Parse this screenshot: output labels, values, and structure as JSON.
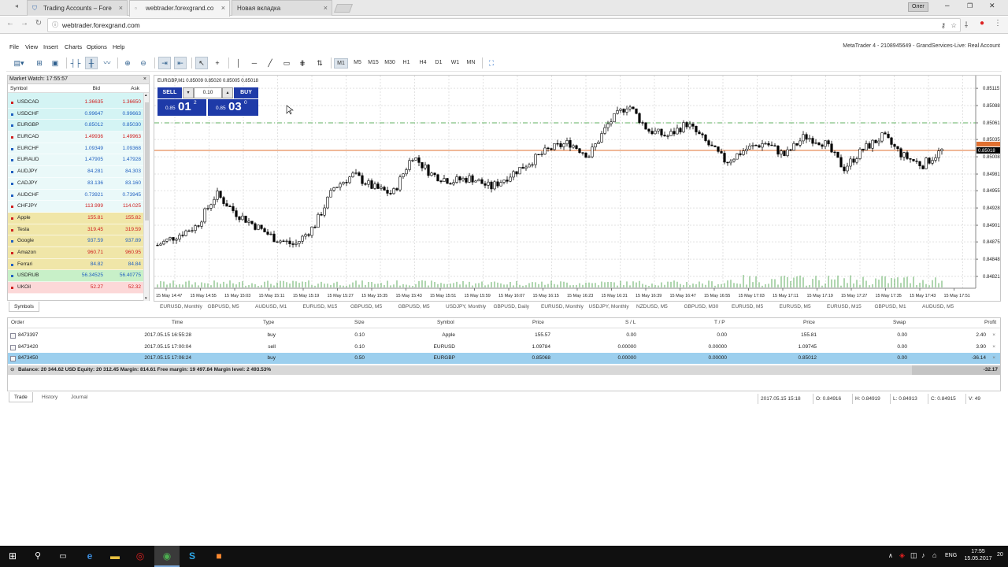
{
  "browser": {
    "user": "Олег",
    "tabs": [
      {
        "title": "Trading Accounts – Fore"
      },
      {
        "title": "webtrader.forexgrand.co"
      },
      {
        "title": "Новая вкладка"
      }
    ],
    "url": "webtrader.forexgrand.com"
  },
  "menu": {
    "items": [
      "File",
      "View",
      "Insert",
      "Charts",
      "Options",
      "Help"
    ],
    "account": "MetaTrader 4 - 2108945649 - GrandServices-Live: Real Account"
  },
  "toolbar": {
    "timeframes": [
      "M1",
      "M5",
      "M15",
      "M30",
      "H1",
      "H4",
      "D1",
      "W1",
      "MN"
    ],
    "active_timeframe": "M1"
  },
  "market_watch": {
    "title": "Market Watch: 17:55:57",
    "cols": {
      "symbol": "Symbol",
      "bid": "Bid",
      "ask": "Ask"
    },
    "rows": [
      {
        "symbol": "USDCAD",
        "bid": "1.36635",
        "ask": "1.36650",
        "dir": "down",
        "group": "fx"
      },
      {
        "symbol": "USDCHF",
        "bid": "0.99647",
        "ask": "0.99663",
        "dir": "up",
        "group": "fx"
      },
      {
        "symbol": "EURGBP",
        "bid": "0.85012",
        "ask": "0.85030",
        "dir": "up",
        "group": "fx"
      },
      {
        "symbol": "EURCAD",
        "bid": "1.49936",
        "ask": "1.49963",
        "dir": "down",
        "group": "fx2"
      },
      {
        "symbol": "EURCHF",
        "bid": "1.09349",
        "ask": "1.09368",
        "dir": "up",
        "group": "fx2"
      },
      {
        "symbol": "EURAUD",
        "bid": "1.47905",
        "ask": "1.47928",
        "dir": "up",
        "group": "fx2"
      },
      {
        "symbol": "AUDJPY",
        "bid": "84.281",
        "ask": "84.303",
        "dir": "up",
        "group": "fx2"
      },
      {
        "symbol": "CADJPY",
        "bid": "83.136",
        "ask": "83.160",
        "dir": "up",
        "group": "fx2"
      },
      {
        "symbol": "AUDCHF",
        "bid": "0.73921",
        "ask": "0.73945",
        "dir": "up",
        "group": "fx2"
      },
      {
        "symbol": "CHFJPY",
        "bid": "113.999",
        "ask": "114.025",
        "dir": "down",
        "group": "fx2"
      },
      {
        "symbol": "Apple",
        "bid": "155.81",
        "ask": "155.82",
        "dir": "down",
        "group": "stock"
      },
      {
        "symbol": "Tesla",
        "bid": "319.45",
        "ask": "319.59",
        "dir": "down",
        "group": "stock"
      },
      {
        "symbol": "Google",
        "bid": "937.59",
        "ask": "937.89",
        "dir": "up",
        "group": "stock"
      },
      {
        "symbol": "Amazon",
        "bid": "960.71",
        "ask": "960.95",
        "dir": "down",
        "group": "stock"
      },
      {
        "symbol": "Ferrari",
        "bid": "84.82",
        "ask": "84.84",
        "dir": "up",
        "group": "stock"
      },
      {
        "symbol": "USDRUB",
        "bid": "56.34525",
        "ask": "56.40775",
        "dir": "up",
        "group": "rub"
      },
      {
        "symbol": "UKOil",
        "bid": "52.27",
        "ask": "52.32",
        "dir": "down",
        "group": "oil"
      }
    ],
    "symbols_tab": "Symbols"
  },
  "chart": {
    "info": "EURGBP,M1  0.85009 0.85020 0.85005 0.85018",
    "sell_label": "SELL",
    "buy_label": "BUY",
    "lot": "0.10",
    "sell_small": "0.85",
    "sell_big": "01",
    "sell_sup": "2",
    "buy_small": "0.85",
    "buy_big": "03",
    "buy_sup": "0",
    "price_labels": [
      "0.85115",
      "0.85088",
      "0.85061",
      "0.85035",
      "0.85008",
      "0.84981",
      "0.84955",
      "0.84928",
      "0.84901",
      "0.84875",
      "0.84848",
      "0.84821"
    ],
    "current_price": "0.85018",
    "time_labels": [
      "15 May 14:47",
      "15 May 14:55",
      "15 May 15:03",
      "15 May 15:11",
      "15 May 15:19",
      "15 May 15:27",
      "15 May 15:35",
      "15 May 15:43",
      "15 May 15:51",
      "15 May 15:59",
      "15 May 16:07",
      "15 May 16:15",
      "15 May 16:23",
      "15 May 16:31",
      "15 May 16:39",
      "15 May 16:47",
      "15 May 16:55",
      "15 May 17:03",
      "15 May 17:11",
      "15 May 17:19",
      "15 May 17:27",
      "15 May 17:35",
      "15 May 17:43",
      "15 May 17:51"
    ],
    "tabs": [
      "EURUSD, Monthly",
      "GBPUSD, M5",
      "AUDUSD, M1",
      "EURUSD, M15",
      "GBPUSD, M5",
      "GBPUSD, M5",
      "USDJPY, Monthly",
      "GBPUSD, Daily",
      "EURUSD, Monthly",
      "USDJPY, Monthly",
      "NZDUSD, M5",
      "GBPUSD, M30",
      "EURUSD, M5",
      "EURUSD, M5",
      "EURUSD, M15",
      "GBPUSD, M1",
      "AUDUSD, M5"
    ]
  },
  "chart_data": {
    "type": "candlestick",
    "symbol": "EURGBP",
    "timeframe": "M1",
    "ylim": [
      0.8481,
      0.85125
    ],
    "x_range": [
      "15 May 14:47",
      "15 May 17:55"
    ],
    "ask_line": 0.85061,
    "bid_line": 0.85018,
    "close_path": [
      0.8487,
      0.84885,
      0.849,
      0.8495,
      0.8492,
      0.849,
      0.8488,
      0.8487,
      0.849,
      0.8496,
      0.8498,
      0.8496,
      0.8495,
      0.8501,
      0.8498,
      0.8497,
      0.84975,
      0.8496,
      0.8498,
      0.85,
      0.8502,
      0.8503,
      0.8501,
      0.8506,
      0.8509,
      0.8505,
      0.8504,
      0.8506,
      0.8503,
      0.85,
      0.8502,
      0.8503,
      0.8501,
      0.8504,
      0.8503,
      0.8499,
      0.8502,
      0.8504,
      0.8501,
      0.84995,
      0.85018
    ]
  },
  "terminal": {
    "headers": [
      "Order",
      "Time",
      "Type",
      "Size",
      "Symbol",
      "Price",
      "S / L",
      "T / P",
      "Price",
      "Swap",
      "Profit"
    ],
    "rows": [
      {
        "order": "8473397",
        "time": "2017.05.15 16:55:28",
        "type": "buy",
        "size": "0.10",
        "symbol": "Apple",
        "price": "155.57",
        "sl": "0.00",
        "tp": "0.00",
        "cur": "155.81",
        "swap": "0.00",
        "profit": "2.40",
        "selected": false
      },
      {
        "order": "8473420",
        "time": "2017.05.15 17:00:04",
        "type": "sell",
        "size": "0.10",
        "symbol": "EURUSD",
        "price": "1.09784",
        "sl": "0.00000",
        "tp": "0.00000",
        "cur": "1.09745",
        "swap": "0.00",
        "profit": "3.90",
        "selected": false
      },
      {
        "order": "8473450",
        "time": "2017.05.15 17:06:24",
        "type": "buy",
        "size": "0.50",
        "symbol": "EURGBP",
        "price": "0.85068",
        "sl": "0.00000",
        "tp": "0.00000",
        "cur": "0.85012",
        "swap": "0.00",
        "profit": "-36.14",
        "selected": true
      }
    ],
    "balance": "Balance: 20 344.62 USD  Equity: 20 312.45  Margin: 814.61  Free margin: 19 497.84  Margin level: 2 493.53%",
    "total": "-32.17",
    "tabs": [
      "Trade",
      "History",
      "Journal"
    ]
  },
  "status": {
    "time": "2017.05.15 15:18",
    "open": "O: 0.84916",
    "high": "H: 0.84919",
    "low": "L: 0.84913",
    "close": "C: 0.84915",
    "volume": "V: 49"
  },
  "taskbar": {
    "lang": "ENG",
    "time": "17:55",
    "date": "15.05.2017",
    "notif": "20"
  },
  "colors": {
    "sell_blue": "#1e3aa8",
    "fx_row": "#d4f4f4",
    "stock_row": "#f0e6a8",
    "rub_row": "#c8f0c8",
    "oil_row": "#fcd8d8",
    "up": "#2060c0",
    "down": "#d02020",
    "bid_line": "#e07030",
    "ask_line": "#60b060"
  }
}
